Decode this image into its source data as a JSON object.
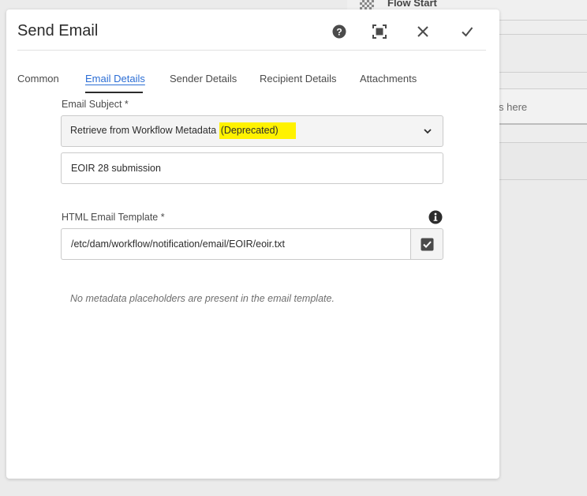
{
  "background": {
    "flow_start_label": "Flow Start",
    "drop_hint_fragment": "s here"
  },
  "dialog": {
    "title": "Send Email",
    "header_icons": [
      "help-icon",
      "fullscreen-icon",
      "close-icon",
      "check-icon"
    ]
  },
  "tabs": [
    {
      "label": "Common",
      "active": false
    },
    {
      "label": "Email Details",
      "active": true
    },
    {
      "label": "Sender Details",
      "active": false
    },
    {
      "label": "Recipient Details",
      "active": false
    },
    {
      "label": "Attachments",
      "active": false
    }
  ],
  "form": {
    "email_subject": {
      "label": "Email Subject *",
      "selected_option_prefix": "Retrieve from Workflow Metadata ",
      "selected_option_highlight": "(Deprecated)",
      "highlight_color": "#fff200",
      "value": "EOIR 28 submission"
    },
    "html_email_template": {
      "label": "HTML Email Template *",
      "value": "/etc/dam/workflow/notification/email/EOIR/eoir.txt"
    },
    "note": "No metadata placeholders are present in the email template."
  },
  "colors": {
    "accent": "#2c6ed5",
    "highlight": "#fff200"
  }
}
